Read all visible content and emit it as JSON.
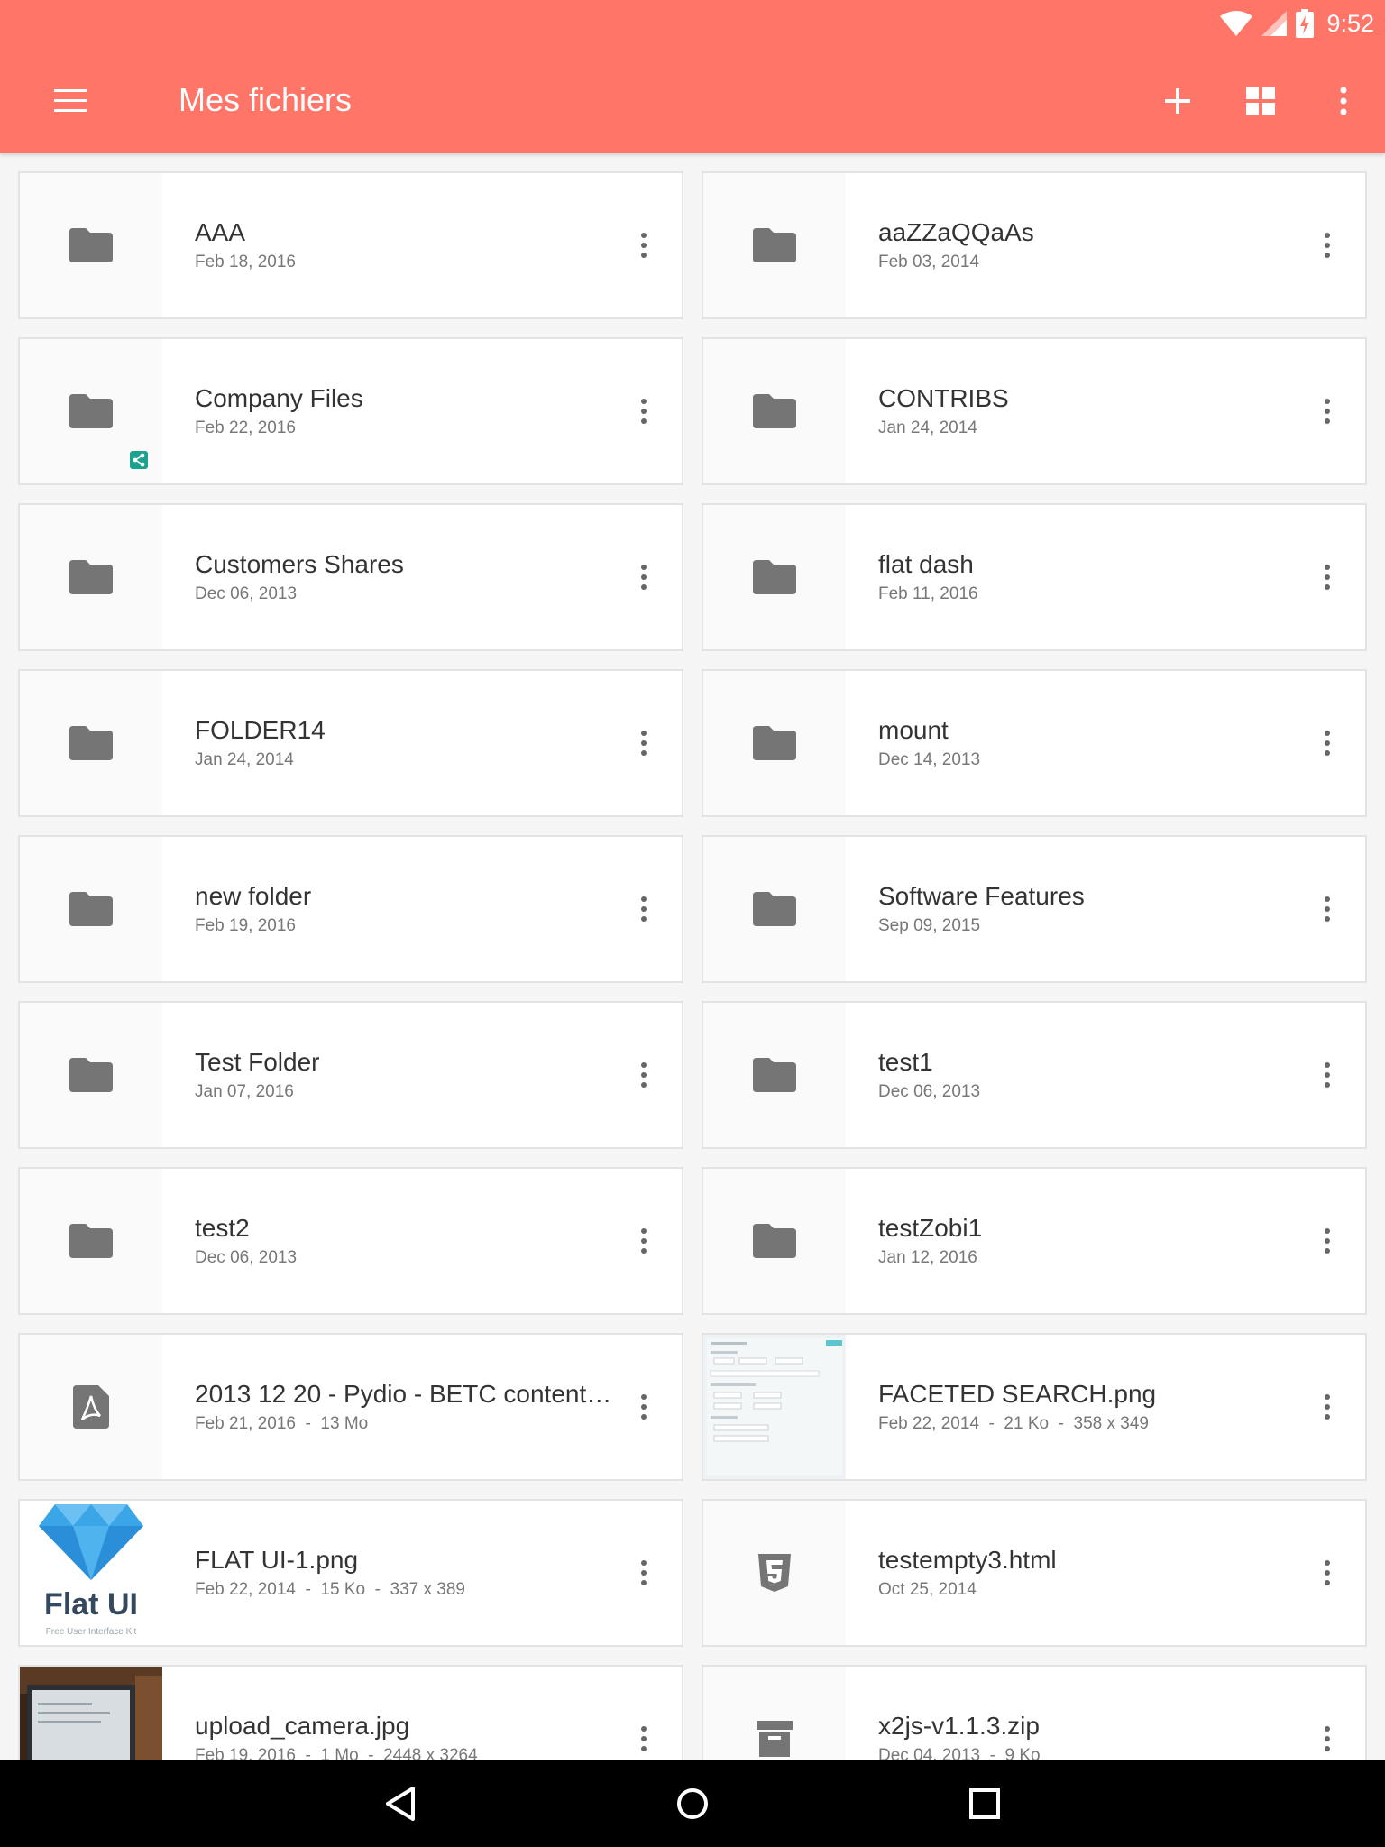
{
  "status_bar": {
    "time": "9:52"
  },
  "toolbar": {
    "title": "Mes fichiers"
  },
  "files": [
    {
      "name": "AAA",
      "meta": "Feb 18, 2016",
      "icon": "folder-icon"
    },
    {
      "name": "aaZZaQQaAs",
      "meta": "Feb 03, 2014",
      "icon": "folder-icon"
    },
    {
      "name": "Company Files",
      "meta": "Feb 22, 2016",
      "icon": "folder-icon",
      "shared": true
    },
    {
      "name": "CONTRIBS",
      "meta": "Jan 24, 2014",
      "icon": "folder-icon"
    },
    {
      "name": "Customers Shares",
      "meta": "Dec 06, 2013",
      "icon": "folder-icon"
    },
    {
      "name": "flat dash",
      "meta": "Feb 11, 2016",
      "icon": "folder-icon"
    },
    {
      "name": "FOLDER14",
      "meta": "Jan 24, 2014",
      "icon": "folder-icon"
    },
    {
      "name": "mount",
      "meta": "Dec 14, 2013",
      "icon": "folder-icon"
    },
    {
      "name": "new folder",
      "meta": "Feb 19, 2016",
      "icon": "folder-icon"
    },
    {
      "name": "Software Features",
      "meta": "Sep 09, 2015",
      "icon": "folder-icon"
    },
    {
      "name": "Test Folder",
      "meta": "Jan 07, 2016",
      "icon": "folder-icon"
    },
    {
      "name": "test1",
      "meta": "Dec 06, 2013",
      "icon": "folder-icon"
    },
    {
      "name": "test2",
      "meta": "Dec 06, 2013",
      "icon": "folder-icon"
    },
    {
      "name": "testZobi1",
      "meta": "Jan 12, 2016",
      "icon": "folder-icon"
    },
    {
      "name": "2013 12 20 - Pydio - BETC content…",
      "meta": "Feb 21, 2016  -  13 Mo",
      "icon": "pdf-icon"
    },
    {
      "name": "FACETED SEARCH.png",
      "meta": "Feb 22, 2014  -  21 Ko  -  358 x 349",
      "icon": "image-thumbnail-faceted"
    },
    {
      "name": "FLAT UI-1.png",
      "meta": "Feb 22, 2014  -  15 Ko  -  337 x 389",
      "icon": "image-thumbnail-flatui"
    },
    {
      "name": "testempty3.html",
      "meta": "Oct 25, 2014",
      "icon": "html5-icon"
    },
    {
      "name": "upload_camera.jpg",
      "meta": "Feb 19, 2016  -  1 Mo  -  2448 x 3264",
      "icon": "image-thumbnail-camera"
    },
    {
      "name": "x2js-v1.1.3.zip",
      "meta": "Dec 04, 2013  -  9 Ko",
      "icon": "archive-icon"
    }
  ],
  "thumbnails": {
    "flatui_logo_text": "Flat UI",
    "flatui_tagline": "Free User Interface Kit"
  },
  "colors": {
    "accent": "#ff7669",
    "icon_grey": "#757575",
    "share_badge": "#1aa28f"
  }
}
